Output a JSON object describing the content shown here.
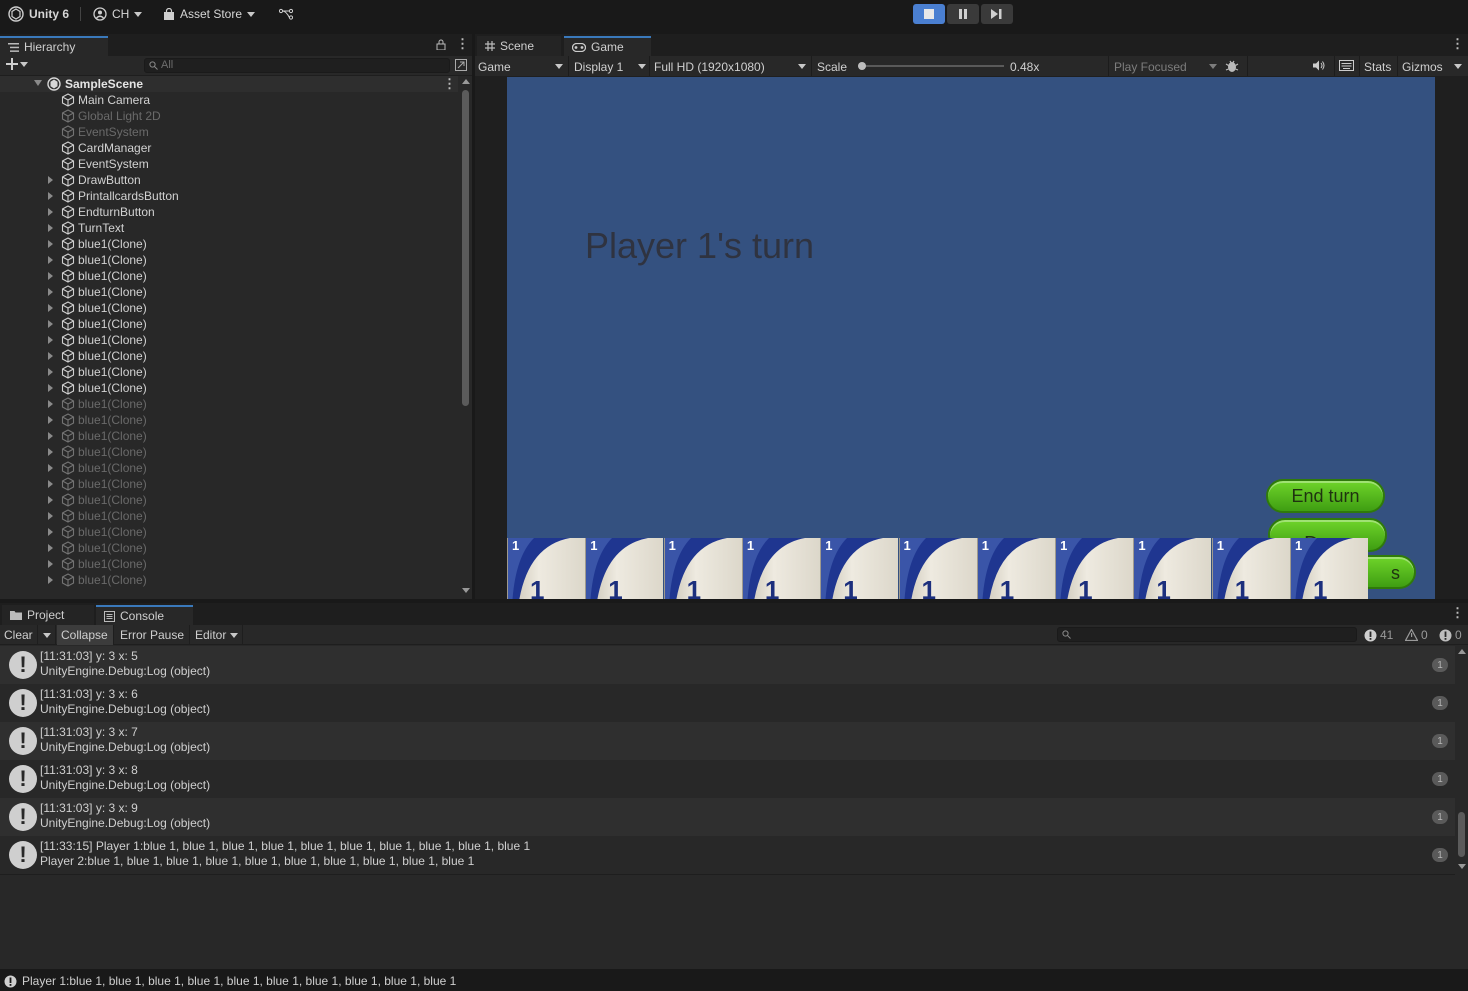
{
  "toolbar": {
    "unity_label": "Unity 6",
    "account_label": "CH",
    "asset_store_label": "Asset Store"
  },
  "hierarchy": {
    "tab_label": "Hierarchy",
    "search_placeholder": "All",
    "scene_name": "SampleScene",
    "items": [
      {
        "label": "Main Camera",
        "active": true,
        "expandable": false
      },
      {
        "label": "Global Light 2D",
        "active": false,
        "expandable": false
      },
      {
        "label": "EventSystem",
        "active": false,
        "expandable": false
      },
      {
        "label": "CardManager",
        "active": true,
        "expandable": false
      },
      {
        "label": "EventSystem",
        "active": true,
        "expandable": false
      },
      {
        "label": "DrawButton",
        "active": true,
        "expandable": true
      },
      {
        "label": "PrintallcardsButton",
        "active": true,
        "expandable": true
      },
      {
        "label": "EndturnButton",
        "active": true,
        "expandable": true
      },
      {
        "label": "TurnText",
        "active": true,
        "expandable": true
      },
      {
        "label": "blue1(Clone)",
        "active": true,
        "expandable": true
      },
      {
        "label": "blue1(Clone)",
        "active": true,
        "expandable": true
      },
      {
        "label": "blue1(Clone)",
        "active": true,
        "expandable": true
      },
      {
        "label": "blue1(Clone)",
        "active": true,
        "expandable": true
      },
      {
        "label": "blue1(Clone)",
        "active": true,
        "expandable": true
      },
      {
        "label": "blue1(Clone)",
        "active": true,
        "expandable": true
      },
      {
        "label": "blue1(Clone)",
        "active": true,
        "expandable": true
      },
      {
        "label": "blue1(Clone)",
        "active": true,
        "expandable": true
      },
      {
        "label": "blue1(Clone)",
        "active": true,
        "expandable": true
      },
      {
        "label": "blue1(Clone)",
        "active": true,
        "expandable": true
      },
      {
        "label": "blue1(Clone)",
        "active": false,
        "expandable": true
      },
      {
        "label": "blue1(Clone)",
        "active": false,
        "expandable": true
      },
      {
        "label": "blue1(Clone)",
        "active": false,
        "expandable": true
      },
      {
        "label": "blue1(Clone)",
        "active": false,
        "expandable": true
      },
      {
        "label": "blue1(Clone)",
        "active": false,
        "expandable": true
      },
      {
        "label": "blue1(Clone)",
        "active": false,
        "expandable": true
      },
      {
        "label": "blue1(Clone)",
        "active": false,
        "expandable": true
      },
      {
        "label": "blue1(Clone)",
        "active": false,
        "expandable": true
      },
      {
        "label": "blue1(Clone)",
        "active": false,
        "expandable": true
      },
      {
        "label": "blue1(Clone)",
        "active": false,
        "expandable": true
      },
      {
        "label": "blue1(Clone)",
        "active": false,
        "expandable": true
      },
      {
        "label": "blue1(Clone)",
        "active": false,
        "expandable": true
      }
    ]
  },
  "game_view": {
    "tabs": [
      {
        "label": "Scene",
        "active": false
      },
      {
        "label": "Game",
        "active": true
      }
    ],
    "mode_select": "Game",
    "display_select": "Display 1",
    "resolution_select": "Full HD (1920x1080)",
    "scale_label": "Scale",
    "scale_value": "0.48x",
    "scale_fraction": 0.0,
    "play_focused_label": "Play Focused",
    "stats_label": "Stats",
    "gizmos_label": "Gizmos",
    "turn_text": "Player 1's turn",
    "buttons": {
      "end_turn": "End turn",
      "draw": "Draw",
      "print_cards_visible": "s"
    },
    "card_rank": "1",
    "card_count": 11
  },
  "console": {
    "tabs": [
      {
        "label": "Project",
        "active": false
      },
      {
        "label": "Console",
        "active": true
      }
    ],
    "toolbar": {
      "clear": "Clear",
      "collapse": "Collapse",
      "error_pause": "Error Pause",
      "editor": "Editor"
    },
    "counts": {
      "log": "41",
      "warning": "0",
      "error": "0"
    },
    "logs": [
      {
        "line1": "[11:31:03] y: 3 x: 5",
        "line2": "UnityEngine.Debug:Log (object)",
        "count": "1"
      },
      {
        "line1": "[11:31:03] y: 3 x: 6",
        "line2": "UnityEngine.Debug:Log (object)",
        "count": "1"
      },
      {
        "line1": "[11:31:03] y: 3 x: 7",
        "line2": "UnityEngine.Debug:Log (object)",
        "count": "1"
      },
      {
        "line1": "[11:31:03] y: 3 x: 8",
        "line2": "UnityEngine.Debug:Log (object)",
        "count": "1"
      },
      {
        "line1": "[11:31:03] y: 3 x: 9",
        "line2": "UnityEngine.Debug:Log (object)",
        "count": "1"
      },
      {
        "line1": "[11:33:15] Player 1:blue 1, blue 1, blue 1, blue 1, blue 1, blue 1, blue 1, blue 1, blue 1, blue 1",
        "line2": "Player 2:blue 1, blue 1, blue 1, blue 1, blue 1, blue 1, blue 1, blue 1, blue 1, blue 1",
        "count": "1"
      }
    ]
  },
  "status_bar": {
    "message": "Player 1:blue 1, blue 1, blue 1, blue 1, blue 1, blue 1, blue 1, blue 1, blue 1, blue 1"
  },
  "colors": {
    "game_background": "#345180",
    "accent": "#4a7fd1",
    "button_green": "#56b81d",
    "card_blue": "#1c2f7d"
  }
}
